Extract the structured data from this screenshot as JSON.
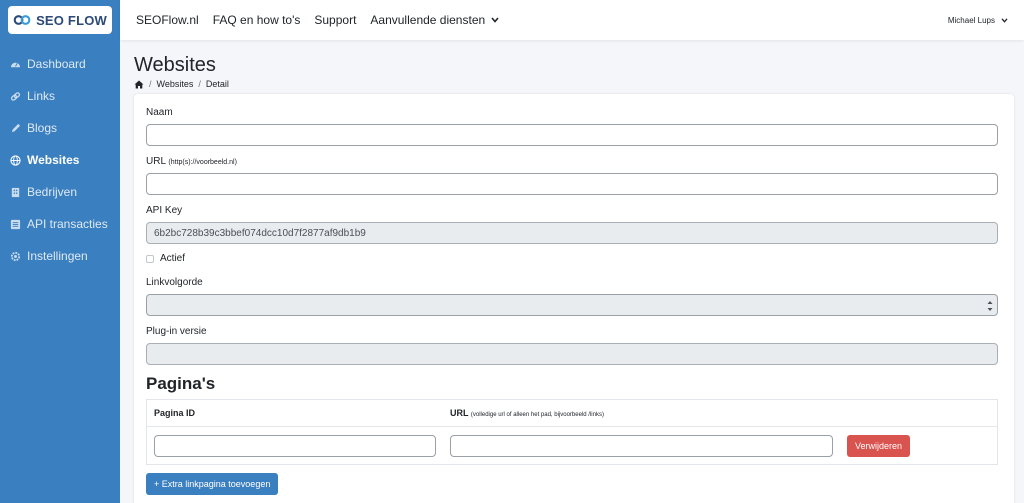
{
  "app": {
    "logo_text": "SEO FLOW"
  },
  "sidebar": {
    "items": [
      {
        "label": "Dashboard",
        "icon": "dashboard-icon",
        "active": false
      },
      {
        "label": "Links",
        "icon": "link-icon",
        "active": false
      },
      {
        "label": "Blogs",
        "icon": "blog-icon",
        "active": false
      },
      {
        "label": "Websites",
        "icon": "globe-icon",
        "active": true
      },
      {
        "label": "Bedrijven",
        "icon": "building-icon",
        "active": false
      },
      {
        "label": "API transacties",
        "icon": "transactions-icon",
        "active": false
      },
      {
        "label": "Instellingen",
        "icon": "gear-icon",
        "active": false
      }
    ]
  },
  "topnav": {
    "links": [
      "SEOFlow.nl",
      "FAQ en how to's",
      "Support"
    ],
    "dropdown_label": "Aanvullende diensten",
    "user_name": "Michael Lups"
  },
  "page": {
    "title": "Websites",
    "breadcrumb": [
      "Websites",
      "Detail"
    ]
  },
  "form": {
    "name_label": "Naam",
    "name_value": "",
    "url_label": "URL",
    "url_hint": "(http(s)://voorbeeld.nl)",
    "url_value": "",
    "api_key_label": "API Key",
    "api_key_value": "6b2bc728b39c3bbef074dcc10d7f2877af9db1b9",
    "active_label": "Actief",
    "link_order_label": "Linkvolgorde",
    "link_order_value": "",
    "plugin_label": "Plug-in versie",
    "plugin_value": ""
  },
  "pages": {
    "title": "Pagina's",
    "col_id": "Pagina ID",
    "col_url": "URL",
    "col_url_hint": "(volledige url of alleen het pad, bijvoorbeeld /links)",
    "row_id_value": "",
    "row_url_value": "",
    "remove_label": "Verwijderen",
    "add_label": "+ Extra linkpagina toevoegen"
  },
  "colors": {
    "sidebar": "#3a7fbf",
    "primary": "#3a7fbf",
    "danger": "#d9534f"
  }
}
